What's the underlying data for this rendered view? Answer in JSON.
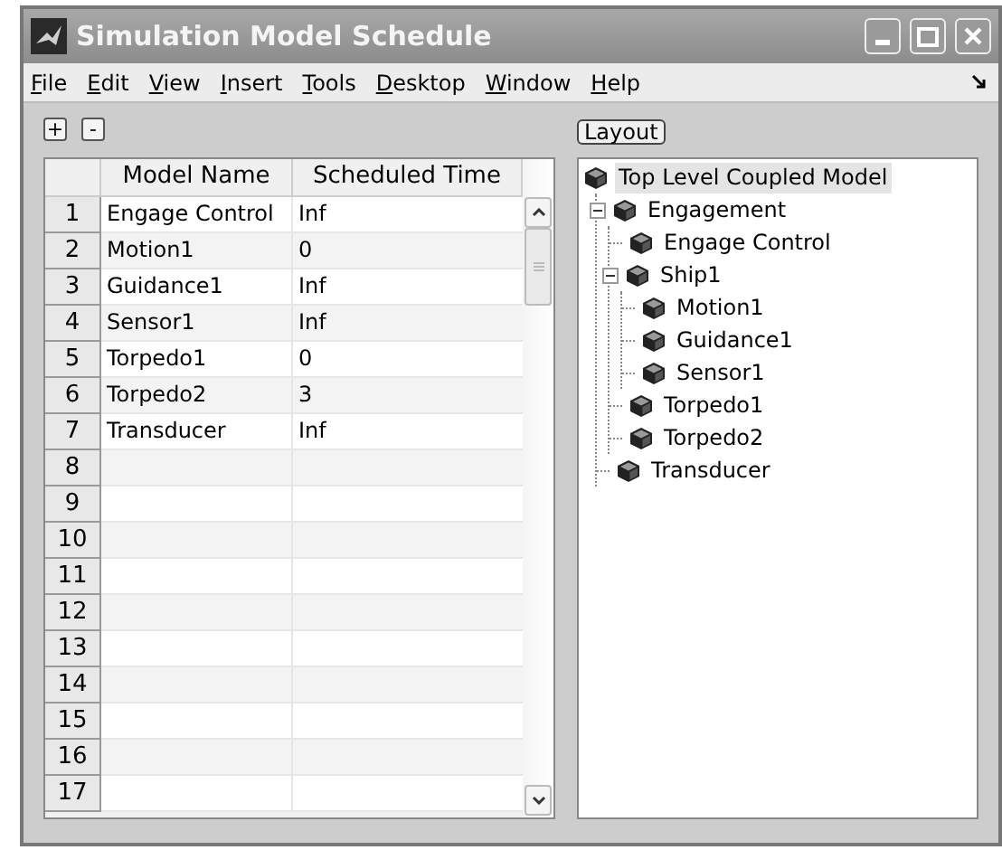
{
  "window": {
    "title": "Simulation Model Schedule"
  },
  "menu": [
    "File",
    "Edit",
    "View",
    "Insert",
    "Tools",
    "Desktop",
    "Window",
    "Help"
  ],
  "toolbar": {
    "expand_button": "+",
    "collapse_button": "-",
    "layout_button": "Layout"
  },
  "table": {
    "columns": [
      "Model Name",
      "Scheduled Time"
    ],
    "rows": [
      {
        "number": "1",
        "name": "Engage Control",
        "time": "Inf"
      },
      {
        "number": "2",
        "name": "Motion1",
        "time": "0"
      },
      {
        "number": "3",
        "name": "Guidance1",
        "time": "Inf"
      },
      {
        "number": "4",
        "name": "Sensor1",
        "time": "Inf"
      },
      {
        "number": "5",
        "name": "Torpedo1",
        "time": "0"
      },
      {
        "number": "6",
        "name": "Torpedo2",
        "time": "3"
      },
      {
        "number": "7",
        "name": "Transducer",
        "time": "Inf"
      },
      {
        "number": "8"
      },
      {
        "number": "9"
      },
      {
        "number": "10"
      },
      {
        "number": "11"
      },
      {
        "number": "12"
      },
      {
        "number": "13"
      },
      {
        "number": "14"
      },
      {
        "number": "15"
      },
      {
        "number": "16"
      },
      {
        "number": "17"
      }
    ]
  },
  "tree": {
    "label": "Top Level Coupled Model",
    "selected": true,
    "children": [
      {
        "label": "Engagement",
        "selected": false,
        "expanded": true,
        "children": [
          {
            "label": "Engage Control",
            "selected": false
          },
          {
            "label": "Ship1",
            "selected": false,
            "expanded": true,
            "children": [
              {
                "label": "Motion1",
                "selected": false
              },
              {
                "label": "Guidance1",
                "selected": false
              },
              {
                "label": "Sensor1",
                "selected": false
              }
            ]
          },
          {
            "label": "Torpedo1",
            "selected": false
          },
          {
            "label": "Torpedo2",
            "selected": false
          }
        ]
      },
      {
        "label": "Transducer",
        "selected": false
      }
    ]
  }
}
